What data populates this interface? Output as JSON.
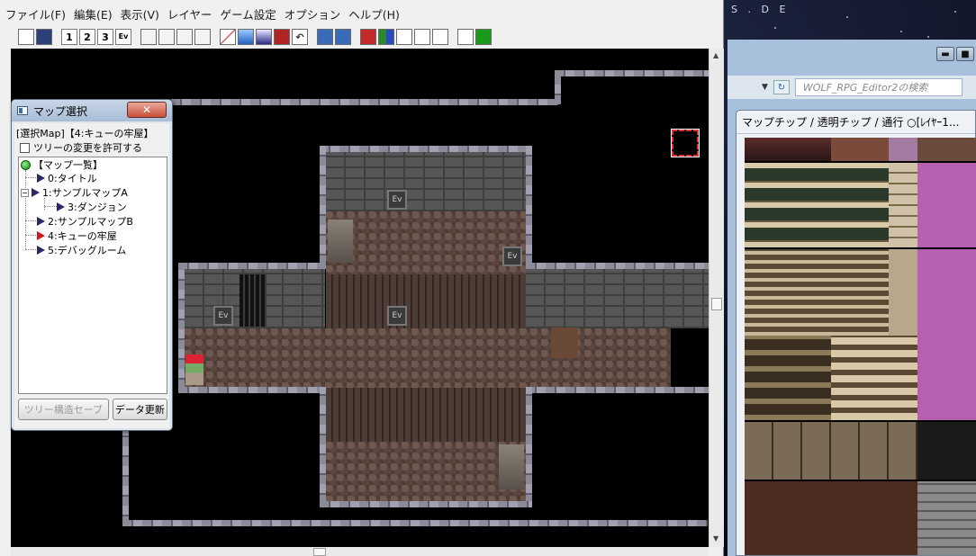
{
  "desktop": {
    "corner_text": "S . D E"
  },
  "editor": {
    "menu": [
      "ファイル(F)",
      "編集(E)",
      "表示(V)",
      "レイヤー",
      "ゲーム設定",
      "オプション",
      "ヘルプ(H)"
    ],
    "toolbar": {
      "layer1": "1",
      "layer2": "2",
      "layer3": "3",
      "event": "Ev"
    },
    "map": {
      "event_label": "Ev"
    }
  },
  "map_select": {
    "title": "マップ選択",
    "close": "✕",
    "selected": "[選択Map]【4:キューの牢屋】",
    "allow_tree_change": "ツリーの変更を許可する",
    "tree": [
      {
        "label": "【マップ一覧】",
        "kind": "root"
      },
      {
        "label": "0:タイトル",
        "kind": "map"
      },
      {
        "label": "1:サンプルマップA",
        "kind": "map"
      },
      {
        "label": "3:ダンジョン",
        "kind": "map"
      },
      {
        "label": "2:サンプルマップB",
        "kind": "map"
      },
      {
        "label": "4:キューの牢屋",
        "kind": "map-selected"
      },
      {
        "label": "5:デバッグルーム",
        "kind": "map"
      }
    ],
    "save_tree_button": "ツリー構造セーブ",
    "update_button": "データ更新"
  },
  "explorer": {
    "search_placeholder": "WOLF_RPG_Editor2の検索",
    "min": "▬",
    "max": "■"
  },
  "palette": {
    "title": "マップチップ / 透明チップ / 通行 ○[ﾚｲﾔｰ1..."
  }
}
